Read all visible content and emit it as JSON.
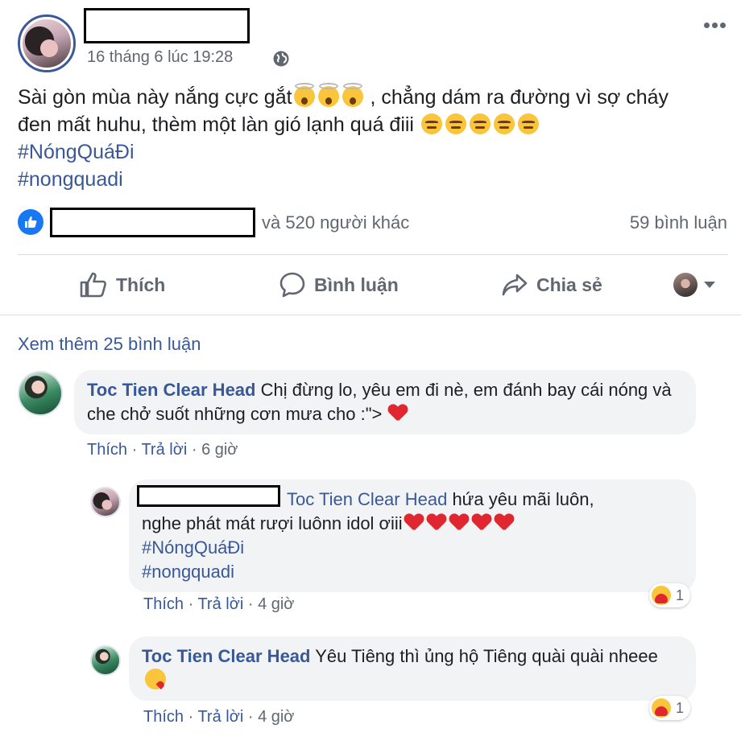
{
  "post": {
    "time": "16 tháng 6 lúc 19:28",
    "privacy_icon": "globe-icon",
    "text_line1": "Sài gòn mùa này nắng cực gắt",
    "text_line1_end": " , chẳng dám ra đường vì sợ cháy",
    "text_line2": "đen mất huhu, thèm một làn gió lạnh quá điii ",
    "hashtags": [
      "#NóngQuáĐi",
      "#nongquadi"
    ]
  },
  "reactions": {
    "others_text": "và 520 người khác",
    "comment_count": "59 bình luận"
  },
  "actions": {
    "like": "Thích",
    "comment": "Bình luận",
    "share": "Chia sẻ"
  },
  "see_more": "Xem thêm 25 bình luận",
  "comments": [
    {
      "author": "Toc Tien Clear Head",
      "text": " Chị đừng lo, yêu em đi nè, em đánh bay cái nóng và che chở suốt những cơn mưa cho :\"> ",
      "like": "Thích",
      "reply": "Trả lời",
      "time": "6 giờ"
    },
    {
      "tag": "Toc Tien Clear Head",
      "text_line1": " hứa yêu mãi luôn,",
      "text_line2": "nghe phát mát rượi luônn idol ơiii",
      "hashtags": [
        "#NóngQuáĐi",
        "#nongquadi"
      ],
      "like": "Thích",
      "reply": "Trả lời",
      "time": "4 giờ",
      "reaction_count": "1"
    },
    {
      "author": "Toc Tien Clear Head",
      "text": " Yêu Tiêng thì ủng hộ Tiêng quài quài nheee ",
      "like": "Thích",
      "reply": "Trả lời",
      "time": "4 giờ",
      "reaction_count": "1"
    }
  ],
  "colors": {
    "link": "#385898",
    "muted": "#606770",
    "bubble": "#f2f3f5",
    "like_blue": "#1877f2"
  }
}
